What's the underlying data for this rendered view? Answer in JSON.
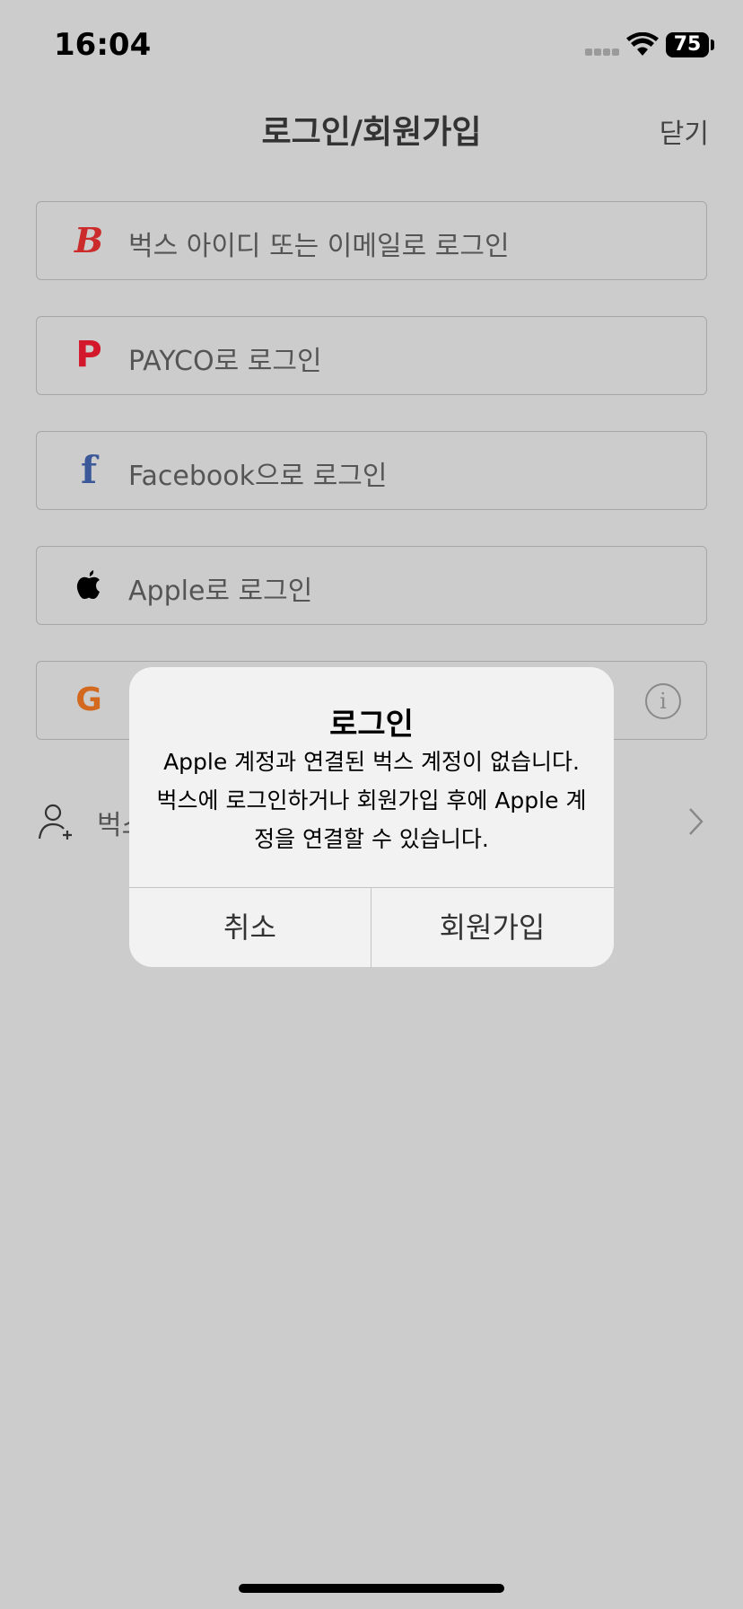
{
  "status_bar": {
    "time": "16:04",
    "battery": "75"
  },
  "nav": {
    "title": "로그인/회원가입",
    "close_label": "닫기"
  },
  "login_options": [
    {
      "label": "벅스 아이디 또는 이메일로 로그인",
      "icon": "bugs-logo-icon",
      "glyph": "B"
    },
    {
      "label": "PAYCO로 로그인",
      "icon": "payco-logo-icon",
      "glyph": "P"
    },
    {
      "label": "Facebook으로 로그인",
      "icon": "facebook-logo-icon",
      "glyph": "f"
    },
    {
      "label": "Apple로 로그인",
      "icon": "apple-logo-icon"
    },
    {
      "icon": "google-logo-icon",
      "glyph": "G",
      "info_glyph": "i"
    }
  ],
  "signup_row": {
    "label": "벅스",
    "icon": "add-user-icon"
  },
  "dialog": {
    "title": "로그인",
    "message": "Apple 계정과 연결된 벅스 계정이 없습니다. 벅스에 로그인하거나 회원가입 후에 Apple 계정을 연결할 수 있습니다.",
    "cancel_label": "취소",
    "confirm_label": "회원가입"
  },
  "colors": {
    "background": "#cccccc",
    "dialog": "#f2f2f2",
    "bugs": "#cc2b2b",
    "payco": "#d3182c",
    "facebook": "#3b5998",
    "google": "#d2691e"
  }
}
